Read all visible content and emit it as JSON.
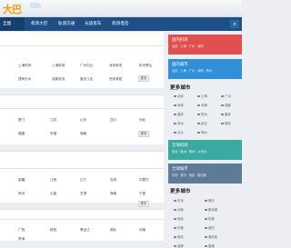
{
  "header": {
    "logo_text": "大巴"
  },
  "nav": {
    "items": [
      "全国",
      "机场大巴",
      "轨道交通",
      "长途客车",
      "机场电话"
    ],
    "search_icon": "search-icon"
  },
  "sections": {
    "s1": {
      "cells": [
        "上海虹桥",
        "上海机场",
        "广州白云",
        "深圳宝安",
        "杭州萧山",
        "昆明长水",
        "成都双流",
        "重庆江北",
        "西安咸阳"
      ],
      "more": "更多"
    },
    "s2": {
      "cells": [
        "厦门",
        "江苏",
        "山东",
        "四川",
        "河北",
        "福建",
        "安徽",
        "湖南"
      ],
      "more": "更多"
    },
    "s3": {
      "cells": [
        "新疆",
        "江西",
        "辽宁",
        "吉林",
        "内蒙古",
        "贵州",
        "云南",
        "甘肃",
        "海南",
        "宁夏"
      ],
      "more": "更多"
    },
    "s4": {
      "cells": [
        "广西",
        "陕西",
        "黑龙江",
        "湖北",
        "河南",
        "青海"
      ]
    }
  },
  "side": {
    "banner1": {
      "title": "国内机场",
      "sub": "北京 · 上海 · 广州 · 深圳"
    },
    "banner2": {
      "title": "国内城市",
      "sub": "北京 · 上海 · 广州 · 深圳 · 杭州"
    },
    "more_cities_1": "更多城市",
    "tags1": [
      "北京",
      "上海",
      "广州",
      "深圳",
      "天津",
      "成都",
      "重庆",
      "杭州",
      "南京",
      "苏州",
      "武汉",
      "西安",
      "长沙",
      "郑州"
    ],
    "banner3": {
      "title": "全球机场",
      "sub": "亚洲 · 欧洲 · 美洲 · 大洋洲"
    },
    "banner4": {
      "title": "全球城市",
      "sub": "东京 · 首尔 · 曼谷 · 新加坡"
    },
    "more_cities_2": "更多城市",
    "tags2": [
      "东京",
      "首尔",
      "大阪",
      "新加坡",
      "曼谷",
      "伦敦",
      "巴黎",
      "纽约",
      "悉尼",
      "洛杉矶",
      "迪拜",
      "香港"
    ]
  },
  "colors": {
    "nav_bg": "#1d4f86",
    "banner_red": "#e0504e",
    "banner_blue": "#2f8fd8",
    "banner_teal": "#3aa9a0",
    "banner_slate": "#5d7a96"
  }
}
